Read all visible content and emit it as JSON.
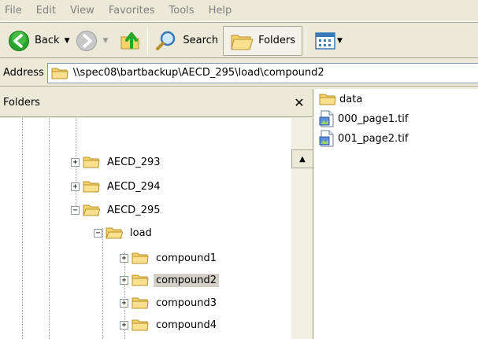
{
  "menu": [
    "File",
    "Edit",
    "View",
    "Favorites",
    "Tools",
    "Help"
  ],
  "toolbar": {
    "back_label": "Back",
    "search_label": "Search",
    "folders_label": "Folders"
  },
  "address": {
    "label": "Address",
    "value": "\\\\spec08\\bartbackup\\AECD_295\\load\\compound2"
  },
  "folders_pane": {
    "title": "Folders",
    "close_glyph": "✕"
  },
  "tree": [
    {
      "label": "AECD_293",
      "expander": "+"
    },
    {
      "label": "AECD_294",
      "expander": "+"
    },
    {
      "label": "AECD_295",
      "expander": "−"
    },
    {
      "label": "load",
      "expander": "−"
    },
    {
      "label": "compound1",
      "expander": "+"
    },
    {
      "label": "compound2",
      "expander": "+",
      "selected": true
    },
    {
      "label": "compound3",
      "expander": "+"
    },
    {
      "label": "compound4",
      "expander": "+"
    }
  ],
  "files": [
    {
      "name": "data",
      "icon": "folder-icon"
    },
    {
      "name": "000_page1.tif",
      "icon": "image-file-icon"
    },
    {
      "name": "001_page2.tif",
      "icon": "image-file-icon"
    }
  ],
  "colors": {
    "chrome": "#ece9d8",
    "back_green": "#2ba42b",
    "folder_yellow": "#f5d36a",
    "selected_bg": "#d4d0c8"
  }
}
